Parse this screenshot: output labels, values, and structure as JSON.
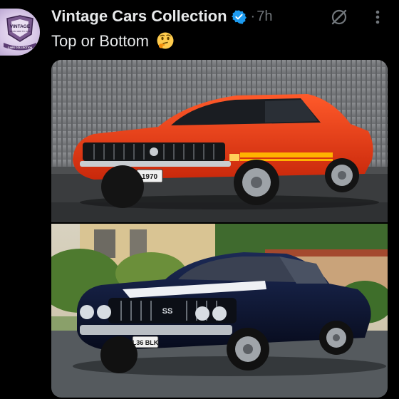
{
  "post": {
    "author_name": "Vintage Cars Collection",
    "separator": "·",
    "timestamp": "7h",
    "text": "Top or Bottom",
    "emoji": "thinking-face",
    "verified": true
  },
  "avatar": {
    "badge_line1": "VINTAGE",
    "badge_line2": "FROM 1900 TO 1970",
    "badge_line3": "CARS COLLECTION"
  },
  "media": {
    "top_photo": {
      "plate": "1970",
      "car_color": "#e8320f"
    },
    "bottom_photo": {
      "plate": "L36 BLK",
      "hood_badge": "SS",
      "car_color": "#0c1430"
    }
  },
  "icons": {
    "verified": "verified-badge-icon",
    "grok": "grok-icon",
    "more": "more-vertical-icon"
  },
  "colors": {
    "background": "#000000",
    "text_primary": "#e7e9ea",
    "text_secondary": "#71767b",
    "verified_blue": "#1d9bf0"
  }
}
